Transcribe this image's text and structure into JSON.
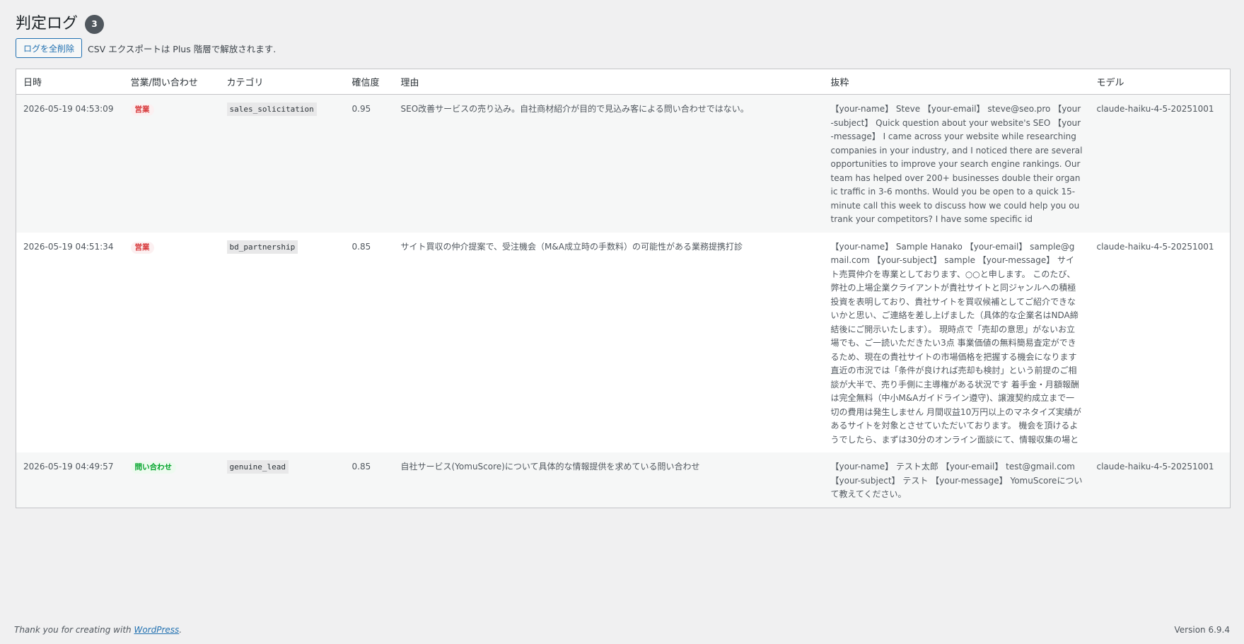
{
  "header": {
    "title": "判定ログ",
    "count": "3",
    "delete_button": "ログを全削除",
    "csv_note": "CSV エクスポートは Plus 階層で解放されます."
  },
  "table": {
    "columns": [
      "日時",
      "営業/問い合わせ",
      "カテゴリ",
      "確信度",
      "理由",
      "抜粋",
      "モデル"
    ],
    "rows": [
      {
        "datetime": "2026-05-19 04:53:09",
        "type": "営業",
        "category": "sales_solicitation",
        "confidence": "0.95",
        "reason": "SEO改善サービスの売り込み。自社商材紹介が目的で見込み客による問い合わせではない。",
        "excerpt": "【your-name】 Steve 【your-email】 steve@seo.pro 【your-subject】 Quick question about your website's SEO 【your-message】 I came across your website while researching companies in your industry, and I noticed there are several opportunities to improve your search engine rankings. Our team has helped over 200+ businesses double their organic traffic in 3-6 months. Would you be open to a quick 15-minute call this week to discuss how we could help you outrank your competitors? I have some specific id",
        "model": "claude-haiku-4-5-20251001"
      },
      {
        "datetime": "2026-05-19 04:51:34",
        "type": "営業",
        "category": "bd_partnership",
        "confidence": "0.85",
        "reason": "サイト買収の仲介提案で、受注機会（M&A成立時の手数料）の可能性がある業務提携打診",
        "excerpt": "【your-name】 Sample Hanako 【your-email】 sample@gmail.com 【your-subject】 sample 【your-message】 サイト売買仲介を専業としております、○○と申します。 このたび、弊社の上場企業クライアントが貴社サイトと同ジャンルへの積極投資を表明しており、貴社サイトを買収候補としてご紹介できないかと思い、ご連絡を差し上げました（具体的な企業名はNDA締結後にご開示いたします）。 現時点で「売却の意思」がないお立場でも、ご一読いただきたい3点 事業価値の無料簡易査定ができるため、現在の貴社サイトの市場価格を把握する機会になります 直近の市況では「条件が良ければ売却も検討」という前提のご相談が大半で、売り手側に主導権がある状況です 着手金・月額報酬は完全無料（中小M&Aガイドライン遵守)、譲渡契約成立まで一切の費用は発生しません 月間収益10万円以上のマネタイズ実績があるサイトを対象とさせていただいております。 機会を頂けるようでしたら、まずは30分のオンライン面談にて、情報収集の場と",
        "model": "claude-haiku-4-5-20251001"
      },
      {
        "datetime": "2026-05-19 04:49:57",
        "type": "問い合わせ",
        "category": "genuine_lead",
        "confidence": "0.85",
        "reason": "自社サービス(YomuScore)について具体的な情報提供を求めている問い合わせ",
        "excerpt": "【your-name】 テスト太郎 【your-email】 test@gmail.com 【your-subject】 テスト 【your-message】 YomuScoreについて教えてください。",
        "model": "claude-haiku-4-5-20251001"
      }
    ]
  },
  "footer": {
    "thanks_prefix": "Thank you for creating with ",
    "thanks_link": "WordPress",
    "thanks_suffix": ".",
    "version": "Version 6.9.4"
  }
}
